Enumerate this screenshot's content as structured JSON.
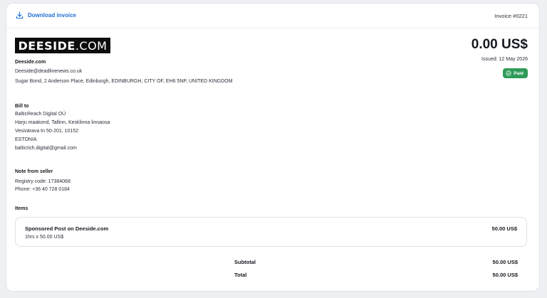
{
  "header": {
    "download_label": "Download invoice",
    "invoice_number": "Invoice #0221"
  },
  "seller": {
    "logo_bold": "DEESIDE",
    "logo_rest": ".COM",
    "name": "Deeside.com",
    "email": "Deeside@deadlinenews.co.uk",
    "address": "Sugar Bond, 2 Anderson Place, Edinburgh, EDINBURGH, CITY OF, EH6 5NP, UNITED KINGDOM"
  },
  "summary": {
    "amount": "0.00 US$",
    "issued": "Issued: 12 May 2026",
    "status": "Paid",
    "status_color": "#2e9b57"
  },
  "bill_to": {
    "heading": "Bill to",
    "lines": [
      "BalticReach Digital OÜ",
      "Harju maakond, Tallinn, Kesklinna linnaosa",
      "Vesivärava tn 50-201, 10152",
      "ESTONIA",
      "balticrich.digital@gmail.com"
    ]
  },
  "note": {
    "heading": "Note from seller",
    "lines": [
      "Registry code: 17384068",
      "Phone: +36 40 728 0184"
    ]
  },
  "items": {
    "heading": "Items",
    "list": [
      {
        "name": "Sponsored Post on Deeside.com",
        "qty": "1hrs x 50.00 US$",
        "price": "50.00 US$"
      }
    ]
  },
  "totals": {
    "subtotal_label": "Subtotal",
    "subtotal_value": "50.00 US$",
    "total_label": "Total",
    "total_value": "50.00 US$"
  },
  "colors": {
    "link": "#1f6fd6",
    "background": "#eef0f4"
  }
}
